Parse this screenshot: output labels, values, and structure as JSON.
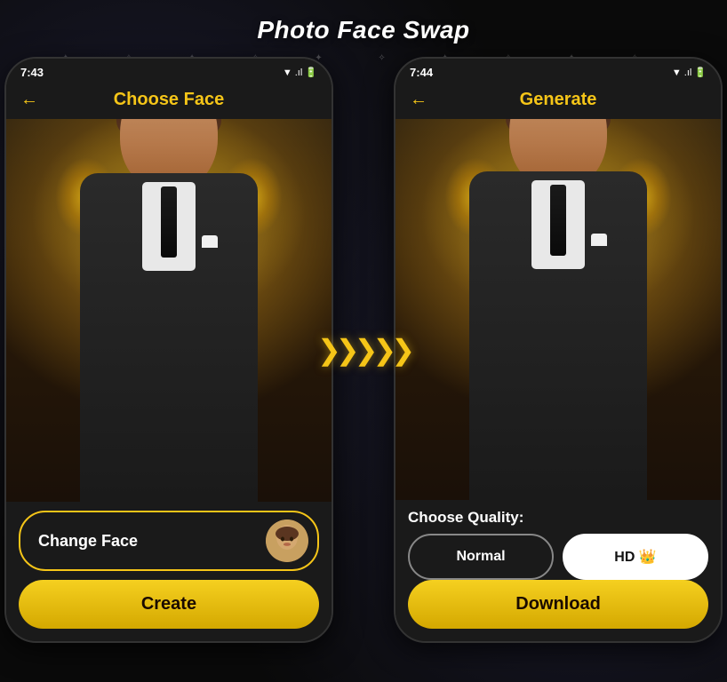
{
  "page": {
    "title": "Photo Face Swap",
    "stars": [
      "✦",
      "✧",
      "✦",
      "✧",
      "✦"
    ]
  },
  "left_phone": {
    "status_time": "7:43",
    "status_icons": "▼ .ıl 🔋",
    "header_title": "Choose Face",
    "back_arrow": "←",
    "change_face_label": "Change Face",
    "create_label": "Create"
  },
  "right_phone": {
    "status_time": "7:44",
    "status_icons": "▼ .ıl 🔋",
    "header_title": "Generate",
    "back_arrow": "←",
    "quality_label": "Choose Quality:",
    "normal_label": "Normal",
    "hd_label": "HD 👑",
    "download_label": "Download"
  },
  "arrow": {
    "symbol": "❯❯❯❯❯"
  }
}
